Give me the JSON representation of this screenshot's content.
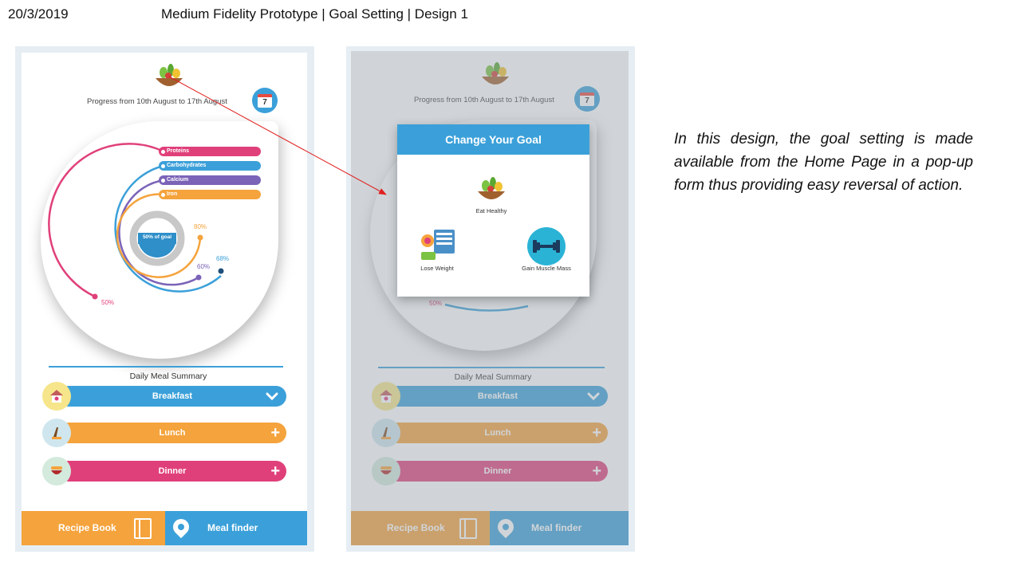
{
  "slide": {
    "date": "20/3/2019",
    "title": "Medium Fidelity Prototype | Goal Setting | Design 1",
    "description": "In this design, the  goal setting is made available from the Home Page in a pop-up form thus providing easy reversal of action."
  },
  "home": {
    "progress_text": "Progress from 10th August to 17th August",
    "calendar_day": "7",
    "center_label": "50% of goal",
    "nutrients": [
      {
        "name": "Proteins",
        "percent": "50%",
        "color": "#e0407a"
      },
      {
        "name": "Carbohydrates",
        "percent": "68%",
        "color": "#3ba0d9"
      },
      {
        "name": "Calcium",
        "percent": "60%",
        "color": "#7b63b8"
      },
      {
        "name": "Iron",
        "percent": "80%",
        "color": "#f5a33c"
      }
    ],
    "daily_meal_summary": "Daily Meal Summary",
    "meals": [
      {
        "label": "Breakfast",
        "action": "⌵",
        "color": "#3ba0d9",
        "icon": "breakfast-icon"
      },
      {
        "label": "Lunch",
        "action": "+",
        "color": "#f5a33c",
        "icon": "lunch-icon"
      },
      {
        "label": "Dinner",
        "action": "+",
        "color": "#e0407a",
        "icon": "dinner-icon"
      }
    ],
    "bottom_nav": {
      "recipe_book": "Recipe Book",
      "meal_finder": "Meal finder"
    }
  },
  "popup": {
    "title": "Change Your Goal",
    "options": [
      {
        "label": "Eat Healthy",
        "icon": "salad-bowl-icon"
      },
      {
        "label": "Lose Weight",
        "icon": "scale-icon"
      },
      {
        "label": "Gain Muscle Mass",
        "icon": "dumbbell-icon"
      }
    ],
    "partial_percent": "50%"
  },
  "colors": {
    "blue": "#3ba0d9",
    "orange": "#f5a33c",
    "pink": "#e0407a",
    "purple": "#7b63b8",
    "annotation_arrow": "#e02020"
  }
}
